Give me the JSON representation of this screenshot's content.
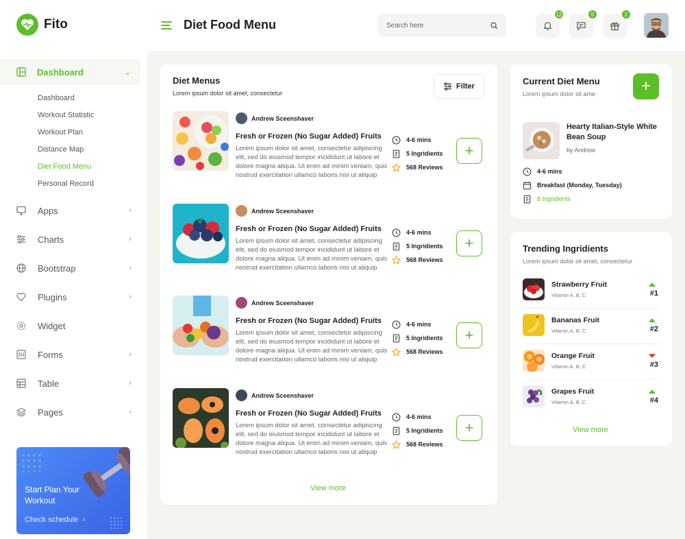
{
  "app": {
    "name": "Fito"
  },
  "header": {
    "title": "Diet Food Menu",
    "search_placeholder": "Search here",
    "notifications_count": "12",
    "messages_count": "5",
    "gifts_count": "2"
  },
  "sidebar": {
    "active": {
      "label": "Dashboard"
    },
    "submenu": [
      "Dashboard",
      "Workout Statistic",
      "Workout Plan",
      "Distance Map",
      "Diet Food Menu",
      "Personal Record"
    ],
    "items": [
      {
        "label": "Apps",
        "icon": "monitor-icon"
      },
      {
        "label": "Charts",
        "icon": "sliders-icon"
      },
      {
        "label": "Bootstrap",
        "icon": "globe-icon"
      },
      {
        "label": "Plugins",
        "icon": "heart-icon"
      },
      {
        "label": "Widget",
        "icon": "settings-icon"
      },
      {
        "label": "Forms",
        "icon": "form-icon"
      },
      {
        "label": "Table",
        "icon": "table-icon"
      },
      {
        "label": "Pages",
        "icon": "layers-icon"
      }
    ],
    "promo": {
      "title": "Start Plan Your Workout",
      "link": "Check schedule"
    }
  },
  "diet_menus": {
    "title": "Diet Menus",
    "subtitle": "Lorem ipsum dolor sit amet, consectetur",
    "filter_label": "Filter",
    "view_more": "View more",
    "items": [
      {
        "author": "Andrew Sceenshaver",
        "title": "Fresh or Frozen (No Sugar Added) Fruits",
        "description": "Lorem ipsum dolor sit amet, consectetur adipiscing elit, sed do eiusmod tempor incididunt ut labore et dolore magna aliqua. Ut enim ad minim veniam, quis nostrud exercitation ullamco laboris nisi ut aliquip",
        "time": "4-6 mins",
        "ingredients": "5 Ingridients",
        "reviews": "568 Reviews",
        "image": "fruit-bowl"
      },
      {
        "author": "Andrew Sceenshaver",
        "title": "Fresh or Frozen (No Sugar Added) Fruits",
        "description": "Lorem ipsum dolor sit amet, consectetur adipiscing elit, sed do eiusmod tempor incididunt ut labore et dolore magna aliqua. Ut enim ad minim veniam, quis nostrud exercitation ullamco laboris nisi ut aliquip",
        "time": "4-6 mins",
        "ingredients": "5 Ingridients",
        "reviews": "568 Reviews",
        "image": "berry-bowl"
      },
      {
        "author": "Andrew Sceenshaver",
        "title": "Fresh or Frozen (No Sugar Added) Fruits",
        "description": "Lorem ipsum dolor sit amet, consectetur adipiscing elit, sed do eiusmod tempor incididunt ut labore et dolore magna aliqua. Ut enim ad minim veniam, quis nostrud exercitation ullamco laboris nisi ut aliquip",
        "time": "4-6 mins",
        "ingredients": "5 Ingridients",
        "reviews": "568 Reviews",
        "image": "hands-vegetables"
      },
      {
        "author": "Andrew Sceenshaver",
        "title": "Fresh or Frozen (No Sugar Added) Fruits",
        "description": "Lorem ipsum dolor sit amet, consectetur adipiscing elit, sed do eiusmod tempor incididunt ut labore et dolore magna aliqua. Ut enim ad minim veniam, quis nostrud exercitation ullamco laboris nisi ut aliquip",
        "time": "4-6 mins",
        "ingredients": "5 Ingridients",
        "reviews": "568 Reviews",
        "image": "papaya-plate"
      }
    ]
  },
  "current_diet": {
    "title": "Current Diet Menu",
    "subtitle": "Lorem ipsum dolor sit ame",
    "dish": "Hearty Italian-Style White Bean Soup",
    "author": "by Andrew",
    "time": "4-6 mins",
    "schedule": "Breakfast (Monday, Tuesday)",
    "ingredients": "8 Ingridients"
  },
  "trending": {
    "title": "Trending Ingridients",
    "subtitle": "Lorem ipsum dolor sit amet, consectetur",
    "view_more": "View more",
    "items": [
      {
        "name": "Strawberry Fruit",
        "vitamins": "Vitamin A, B, C",
        "rank": "#1",
        "trend": "up"
      },
      {
        "name": "Bananas Fruit",
        "vitamins": "Vitamin A, B, C",
        "rank": "#2",
        "trend": "up"
      },
      {
        "name": "Orange Fruit",
        "vitamins": "Vitamin A, B, C",
        "rank": "#3",
        "trend": "down"
      },
      {
        "name": "Grapes Fruit",
        "vitamins": "Vitamin A, B, C",
        "rank": "#4",
        "trend": "up"
      }
    ]
  },
  "colors": {
    "accent": "#5cbf2a",
    "down": "#e23c3c",
    "promo": "#4377f0"
  }
}
